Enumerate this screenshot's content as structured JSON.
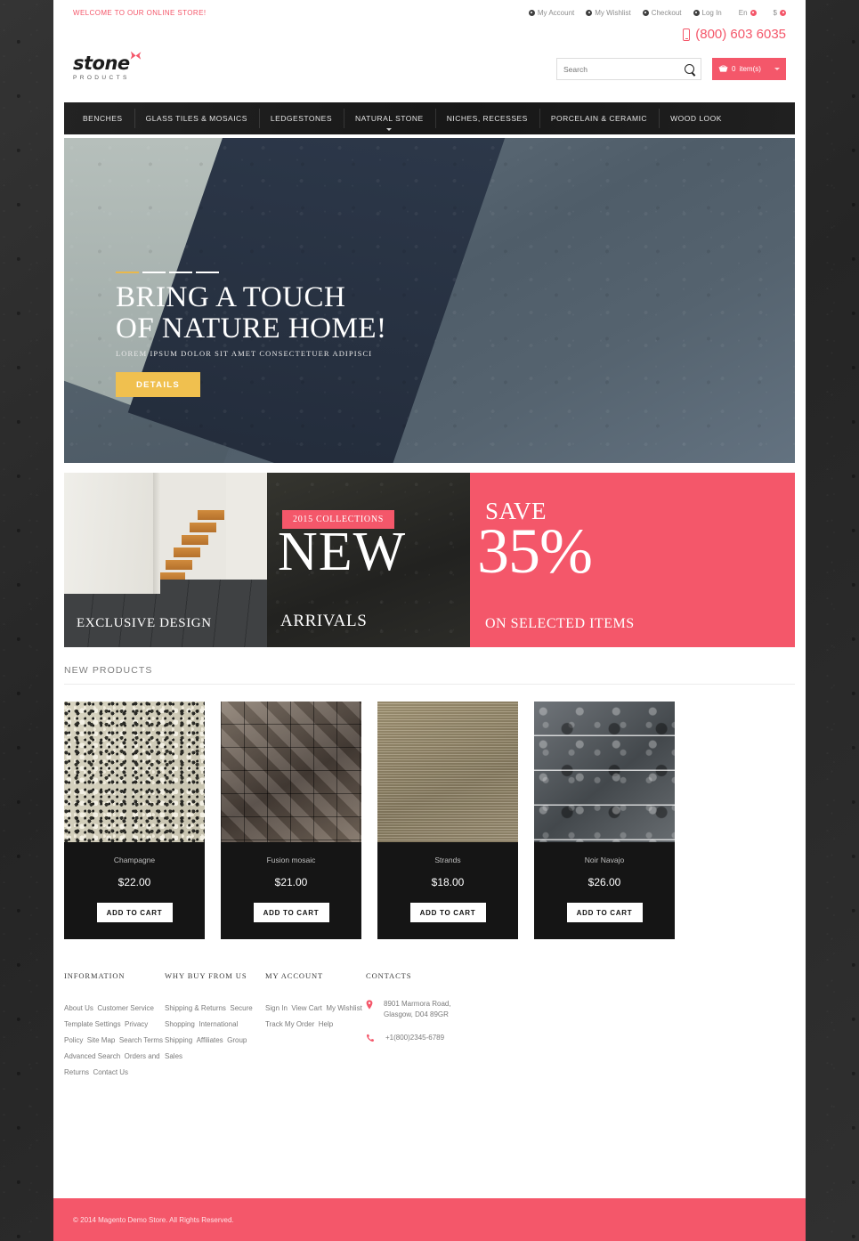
{
  "topbar": {
    "welcome": "WELCOME TO OUR ONLINE STORE!",
    "links": [
      {
        "label": "My Account"
      },
      {
        "label": "My Wishlist"
      },
      {
        "label": "Checkout"
      },
      {
        "label": "Log In"
      }
    ],
    "language": "En",
    "currency": "$"
  },
  "header": {
    "phone": "(800) 603 6035",
    "logo_main": "stone",
    "logo_sub": "PRODUCTS",
    "search_placeholder": "Search",
    "cart_count": "0",
    "cart_label": "item(s)"
  },
  "nav": {
    "items": [
      {
        "label": "BENCHES",
        "has_caret": false
      },
      {
        "label": "GLASS TILES & MOSAICS",
        "has_caret": false
      },
      {
        "label": "LEDGESTONES",
        "has_caret": false
      },
      {
        "label": "NATURAL STONE",
        "has_caret": true
      },
      {
        "label": "NICHES, RECESSES",
        "has_caret": false
      },
      {
        "label": "PORCELAIN & CERAMIC",
        "has_caret": false
      },
      {
        "label": "WOOD LOOK",
        "has_caret": false
      }
    ]
  },
  "hero": {
    "title_line1": "BRING A TOUCH",
    "title_line2": "OF NATURE HOME!",
    "subtitle": "LOREM IPSUM DOLOR SIT AMET CONSECTETUER ADIPISCI",
    "button": "DETAILS"
  },
  "promos": {
    "promo1_label": "EXCLUSIVE DESIGN",
    "promo2_badge": "2015 COLLECTIONS",
    "promo2_big": "NEW",
    "promo2_sub": "ARRIVALS",
    "promo3_save": "SAVE",
    "promo3_percent": "35%",
    "promo3_sub": "ON SELECTED ITEMS"
  },
  "products": {
    "section_title": "NEW PRODUCTS",
    "add_to_cart": "ADD TO CART",
    "items": [
      {
        "name": "Champagne",
        "price": "$22.00"
      },
      {
        "name": "Fusion mosaic",
        "price": "$21.00"
      },
      {
        "name": "Strands",
        "price": "$18.00"
      },
      {
        "name": "Noir Navajo",
        "price": "$26.00"
      }
    ]
  },
  "footer": {
    "columns": [
      {
        "heading": "INFORMATION",
        "links": [
          "About Us",
          "Customer Service",
          "Template Settings",
          "Privacy Policy",
          "Site Map",
          "Search Terms",
          "Advanced Search",
          "Orders and Returns",
          "Contact Us"
        ]
      },
      {
        "heading": "WHY BUY FROM US",
        "links": [
          "Shipping & Returns",
          "Secure Shopping",
          "International Shipping",
          "Affiliates",
          "Group Sales"
        ]
      },
      {
        "heading": "MY ACCOUNT",
        "links": [
          "Sign In",
          "View Cart",
          "My Wishlist",
          "Track My Order",
          "Help"
        ]
      }
    ],
    "contacts_heading": "CONTACTS",
    "address_line1": "8901 Marmora Road,",
    "address_line2": "Glasgow, D04 89GR",
    "phone": "+1(800)2345-6789",
    "copyright": "© 2014 Magento Demo Store. All Rights Reserved."
  },
  "colors": {
    "accent_pink": "#f4576a",
    "hero_button": "#f0c04f",
    "dark": "#151515"
  }
}
